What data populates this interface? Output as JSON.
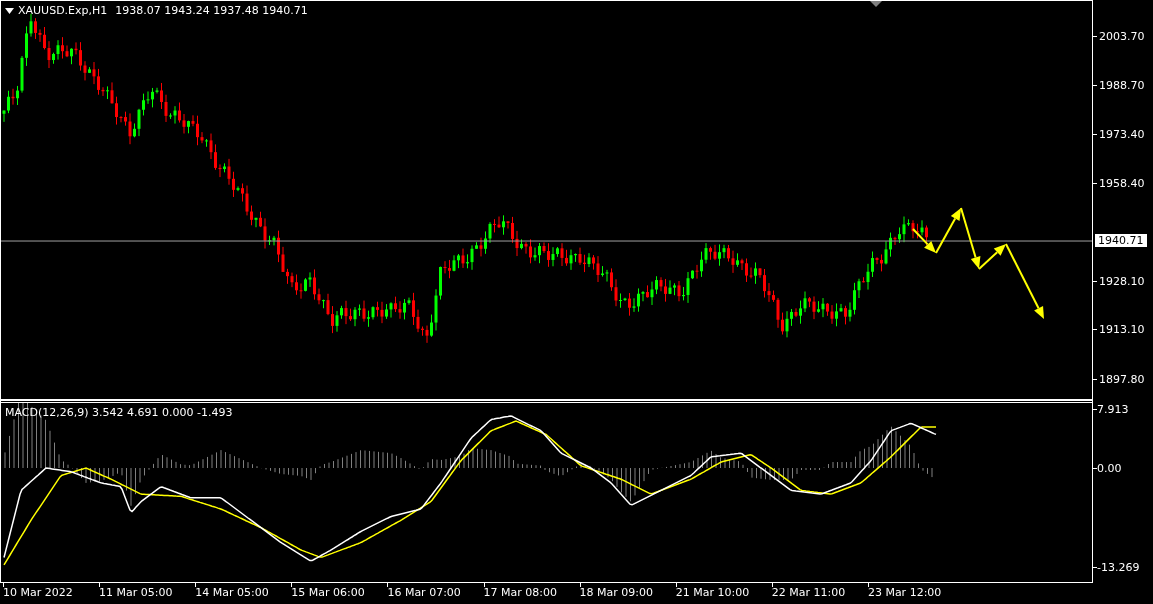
{
  "price_chart": {
    "symbol": "XAUUSD.Exp,H1",
    "ohlc": "1938.07 1943.24 1937.48 1940.71",
    "axis_labels": [
      "2003.70",
      "1988.70",
      "1973.40",
      "1958.40",
      "1928.10",
      "1913.10",
      "1897.80"
    ],
    "current_price": "1940.71"
  },
  "macd": {
    "label": "MACD(12,26,9) 3.542 4.691 0.000 -1.493",
    "axis_labels": [
      "7.913",
      "0.00",
      "-13.269"
    ]
  },
  "time_axis": {
    "labels": [
      "10 Mar 2022",
      "11 Mar 05:00",
      "14 Mar 05:00",
      "15 Mar 06:00",
      "16 Mar 07:00",
      "17 Mar 08:00",
      "18 Mar 09:00",
      "21 Mar 10:00",
      "22 Mar 11:00",
      "23 Mar 12:00"
    ]
  }
}
